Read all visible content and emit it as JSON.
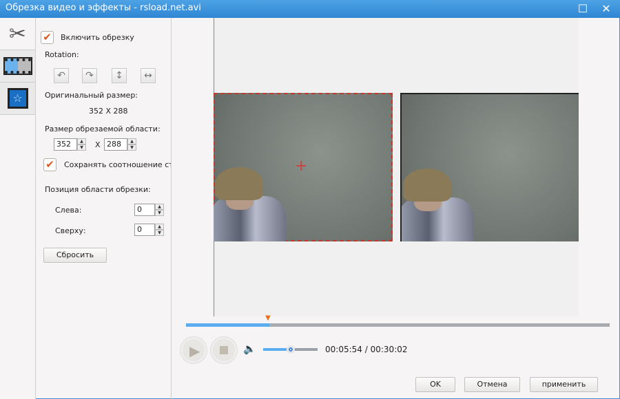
{
  "window": {
    "title": "Обрезка видео и эффекты - rsload.net.avi"
  },
  "tabs": [
    {
      "name": "crop",
      "icon": "scissors-icon"
    },
    {
      "name": "video",
      "icon": "film-icon"
    },
    {
      "name": "effects",
      "icon": "star-icon"
    }
  ],
  "crop": {
    "enable_label": "Включить обрезку",
    "enabled": true,
    "rotation_label": "Rotation:",
    "original_size_label": "Оригинальный размер:",
    "original_size": "352 X 288",
    "crop_size_label": "Размер обрезаемой области:",
    "width": "352",
    "x_sep": "X",
    "height": "288",
    "keep_ratio_label": "Сохранять соотношение сторон",
    "keep_ratio": true,
    "position_label": "Позиция области обрезки:",
    "left_label": "Слева:",
    "left": "0",
    "top_label": "Сверху:",
    "top": "0",
    "reset_label": "Сбросить"
  },
  "player": {
    "position_fraction": 0.197,
    "volume_fraction": 0.5,
    "current_time": "00:05:54",
    "separator": "/",
    "total_time": "00:30:02"
  },
  "buttons": {
    "ok": "OK",
    "cancel": "Отмена",
    "apply": "применить"
  },
  "colors": {
    "accent": "#3a8fd8",
    "crop_border": "#c0392b",
    "progress": "#5aaef0"
  }
}
